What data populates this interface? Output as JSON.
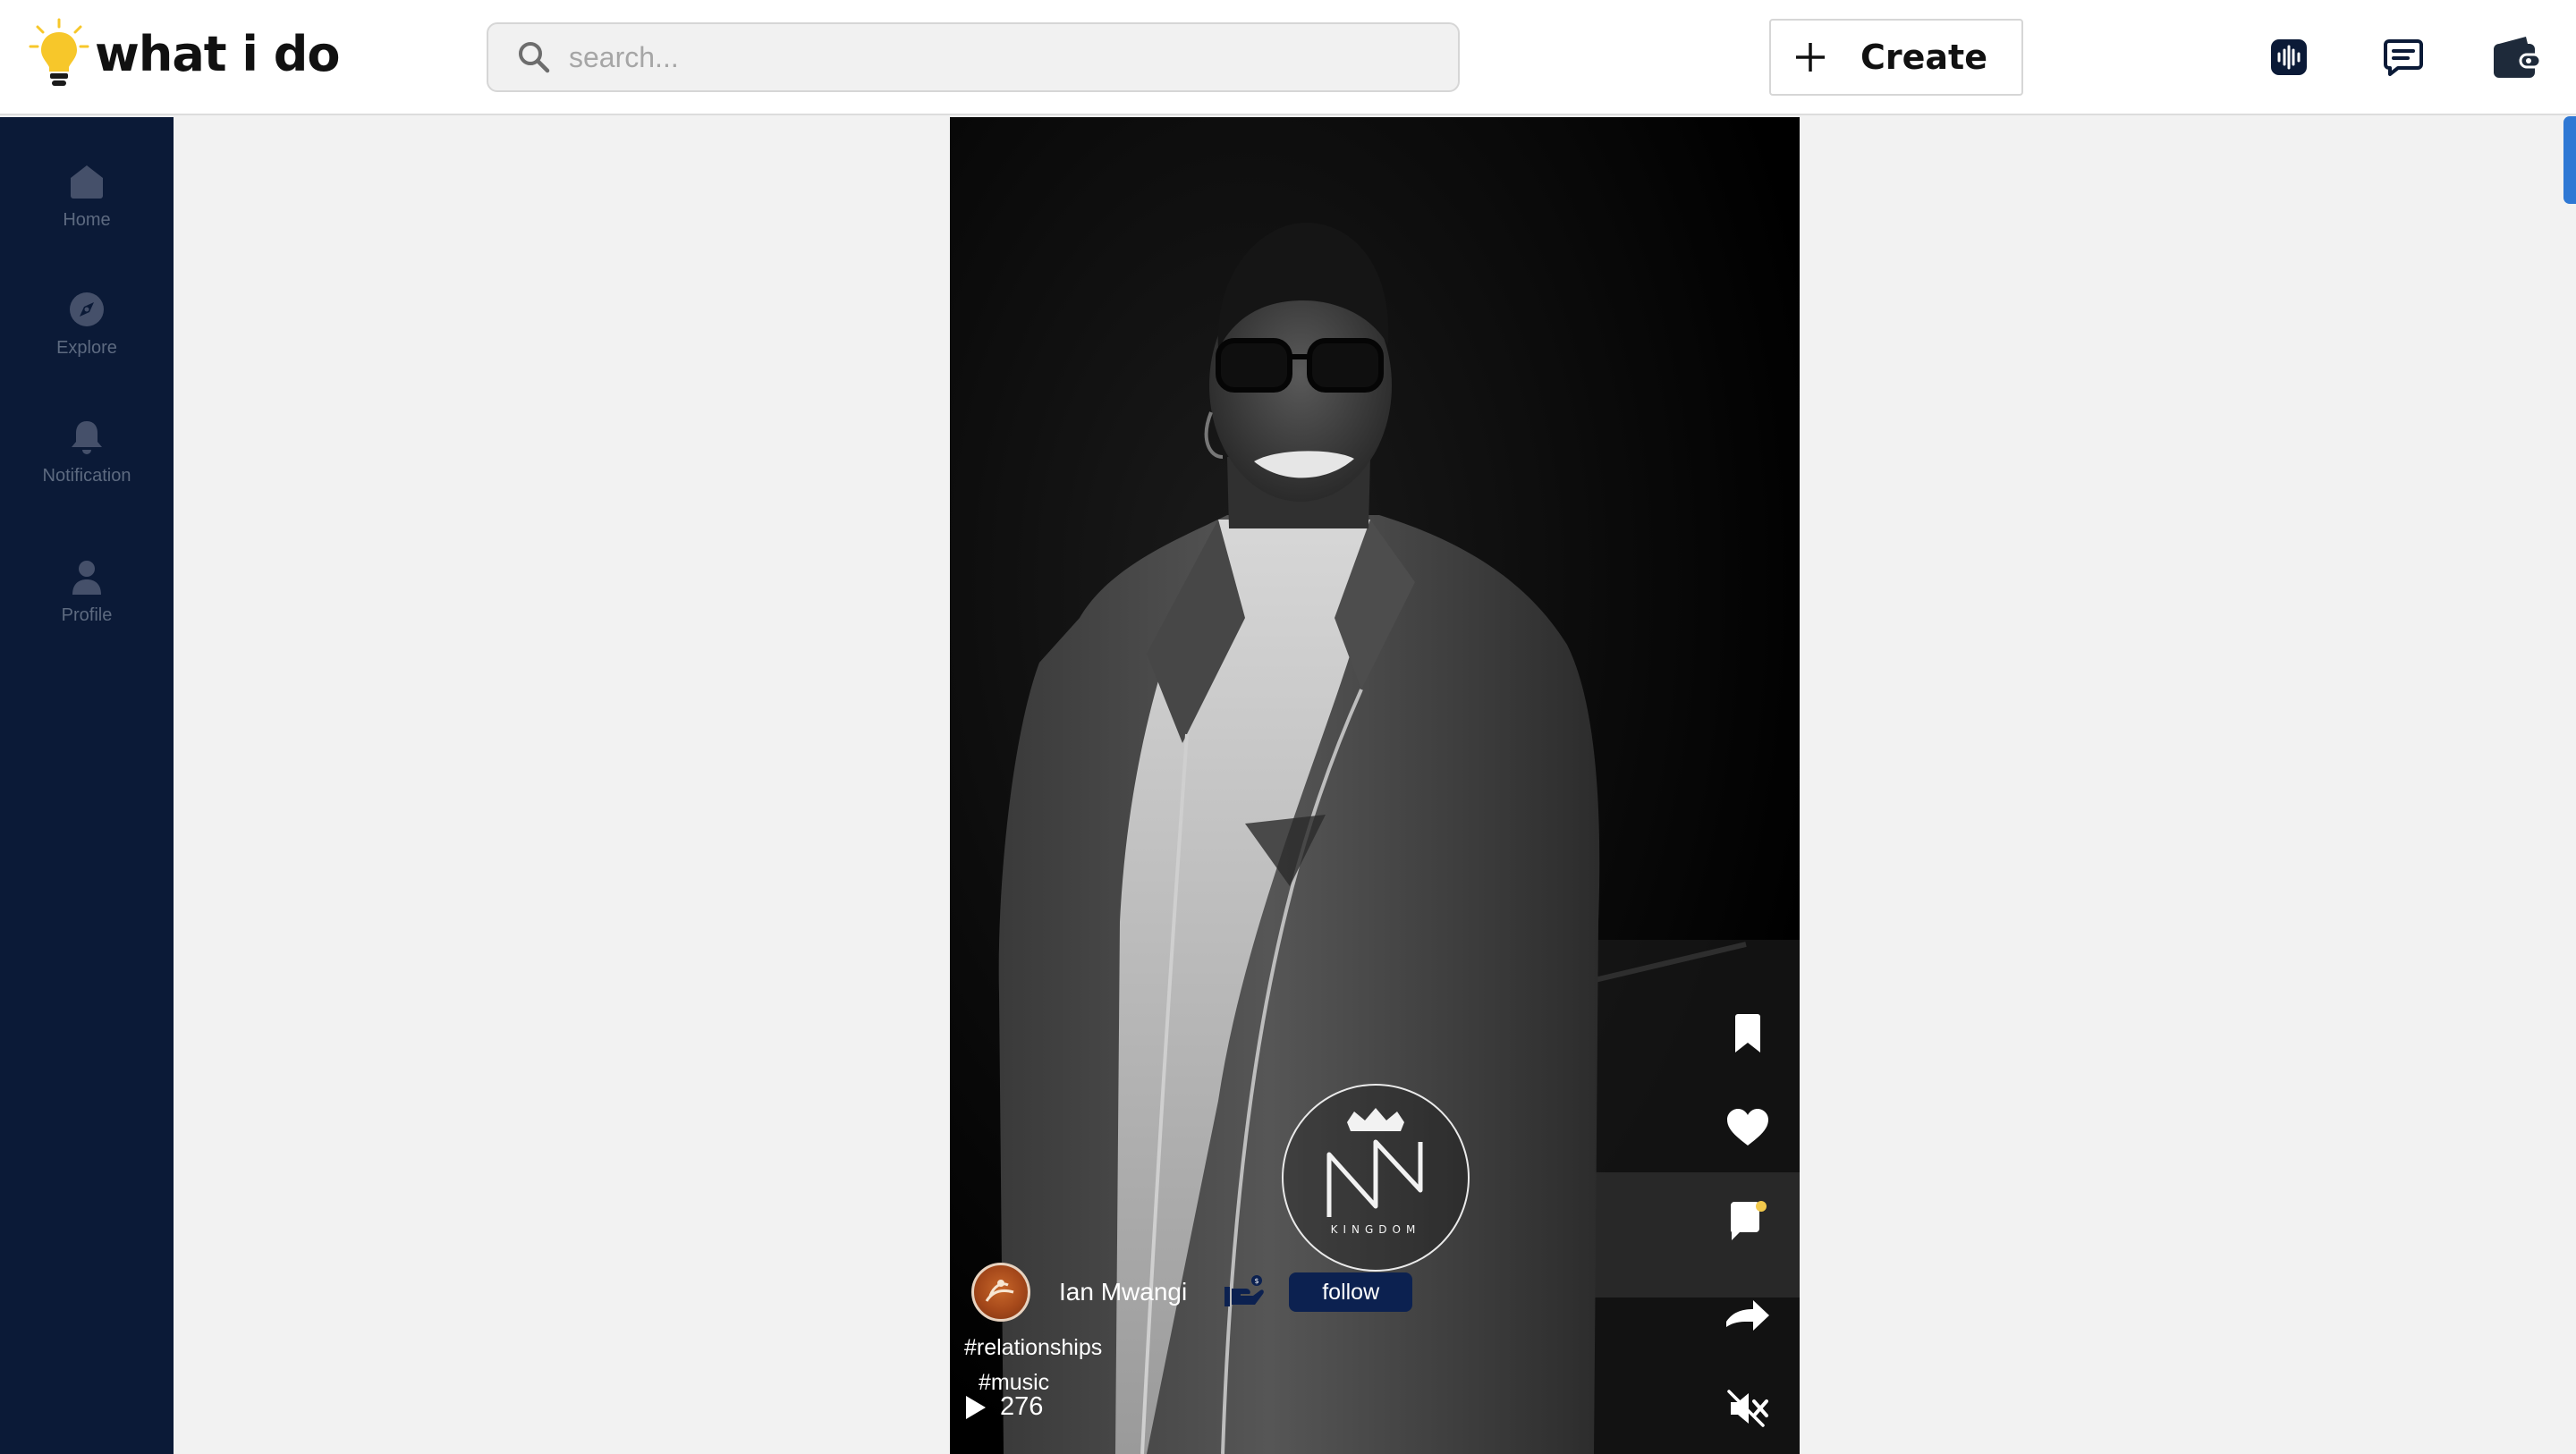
{
  "header": {
    "logo_text": "what i do",
    "search_placeholder": "search...",
    "create_label": "Create",
    "icons": [
      "audio-wave-icon",
      "chat-icon",
      "wallet-icon"
    ]
  },
  "sidebar": {
    "items": [
      {
        "label": "Home",
        "icon": "home-icon"
      },
      {
        "label": "Explore",
        "icon": "compass-icon"
      },
      {
        "label": "Notification",
        "icon": "bell-icon"
      },
      {
        "label": "Profile",
        "icon": "user-icon"
      }
    ]
  },
  "post": {
    "author": "Ian Mwangi",
    "follow_label": "follow",
    "tags": [
      "#relationships",
      "#music"
    ],
    "views": "276",
    "watermark_text": "KINGDOM",
    "actions": [
      "bookmark-icon",
      "heart-icon",
      "comment-icon",
      "share-icon",
      "mute-icon"
    ]
  },
  "colors": {
    "sidebar_bg": "#0b1a37",
    "follow_bg": "#0c2150",
    "accent_blue": "#2f78d4",
    "bulb_yellow": "#f7c72a"
  }
}
